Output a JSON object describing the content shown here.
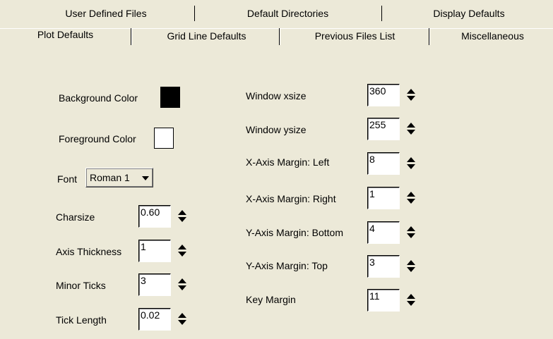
{
  "tabs_back": [
    "User Defined Files",
    "Default Directories",
    "Display Defaults"
  ],
  "tabs_front": [
    "Plot Defaults",
    "Grid Line Defaults",
    "Previous Files List",
    "Miscellaneous"
  ],
  "left": {
    "background_color_label": "Background Color",
    "background_color_value": "#000000",
    "foreground_color_label": "Foreground Color",
    "foreground_color_value": "#ffffff",
    "font_label": "Font",
    "font_value": "Roman 1",
    "charsize_label": "Charsize",
    "charsize_value": "0.60",
    "axis_thickness_label": "Axis Thickness",
    "axis_thickness_value": "1",
    "minor_ticks_label": "Minor Ticks",
    "minor_ticks_value": "3",
    "tick_length_label": "Tick Length",
    "tick_length_value": "0.02"
  },
  "right": {
    "window_xsize_label": "Window xsize",
    "window_xsize_value": "360",
    "window_ysize_label": "Window ysize",
    "window_ysize_value": "255",
    "x_margin_left_label": "X-Axis Margin: Left",
    "x_margin_left_value": "8",
    "x_margin_right_label": "X-Axis Margin: Right",
    "x_margin_right_value": "1",
    "y_margin_bottom_label": "Y-Axis Margin: Bottom",
    "y_margin_bottom_value": "4",
    "y_margin_top_label": "Y-Axis Margin: Top",
    "y_margin_top_value": "3",
    "key_margin_label": "Key Margin",
    "key_margin_value": "11"
  }
}
